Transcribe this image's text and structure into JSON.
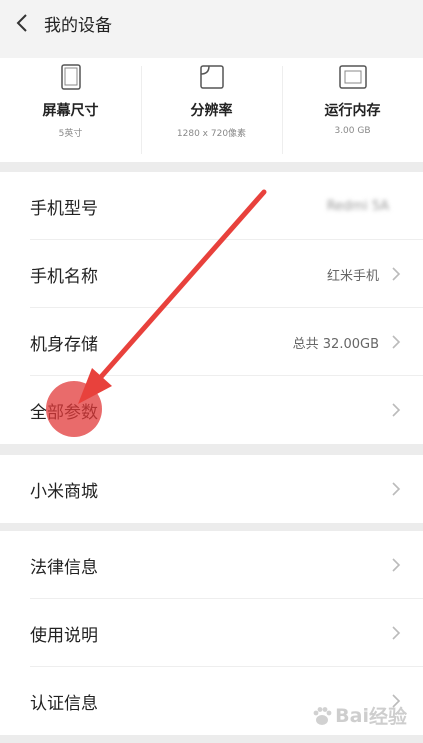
{
  "header": {
    "back_icon": "back-chevron-icon",
    "title": "我的设备"
  },
  "specs": [
    {
      "icon": "screen-size-icon",
      "label": "屏幕尺寸",
      "value": "5英寸"
    },
    {
      "icon": "resolution-icon",
      "label": "分辨率",
      "value": "1280 x 720像素"
    },
    {
      "icon": "memory-icon",
      "label": "运行内存",
      "value": "3.00 GB"
    }
  ],
  "group1": [
    {
      "label": "手机型号",
      "value": "Redmi 5A"
    },
    {
      "label": "手机名称",
      "value": "红米手机"
    },
    {
      "label": "机身存储",
      "value": "总共 32.00GB"
    },
    {
      "label": "全部参数",
      "value": ""
    }
  ],
  "group2": [
    {
      "label": "小米商城"
    }
  ],
  "group3": [
    {
      "label": "法律信息"
    },
    {
      "label": "使用说明"
    },
    {
      "label": "认证信息"
    }
  ],
  "annotation": {
    "arrow_color": "#e8413c",
    "highlight_color": "#e23a3a"
  },
  "watermark": {
    "text": "Bai",
    "suffix": "经验",
    "icon": "baidu-paw-icon"
  }
}
